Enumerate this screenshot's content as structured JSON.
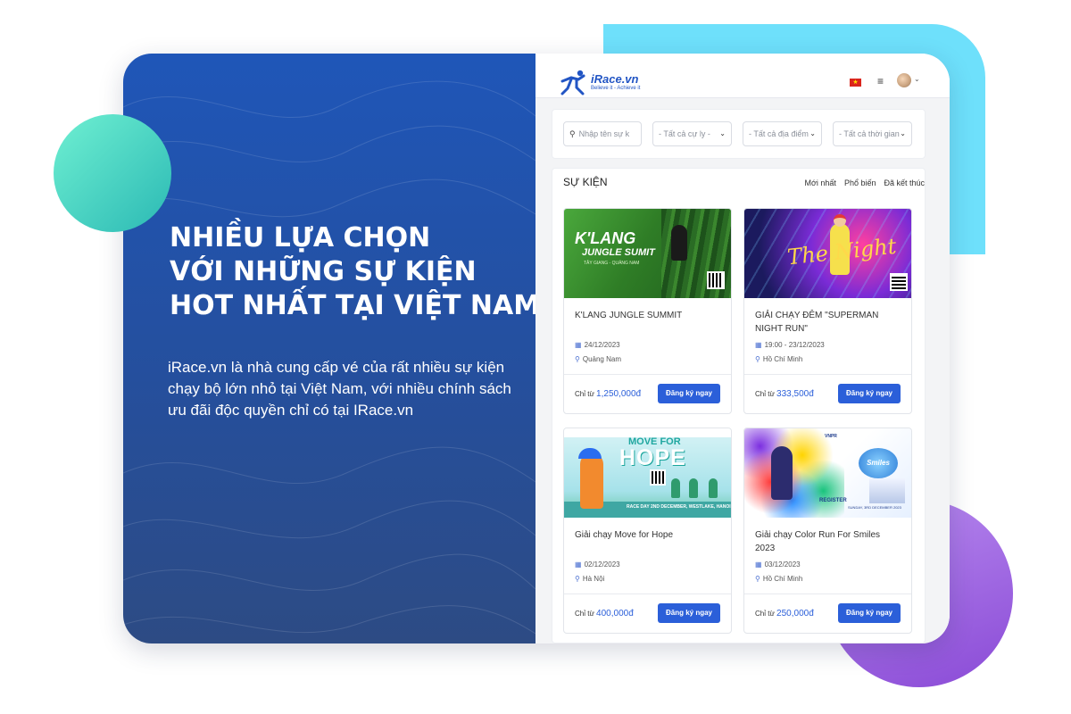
{
  "hero": {
    "headline_lines": [
      "NHIỀU LỰA CHỌN",
      "VỚI NHỮNG SỰ KIỆN",
      "HOT NHẤT TẠI VIỆT NAM"
    ],
    "description": "iRace.vn là nhà cung cấp vé của rất nhiều sự kiện chạy bộ lớn nhỏ tại Việt Nam, với nhiều chính sách ưu đãi độc quyền chỉ có tại IRace.vn"
  },
  "app": {
    "logo_title": "iRace.vn",
    "logo_tagline": "Believe it - Achieve it",
    "menu_icon": "hamburger-menu-icon",
    "flag": "vietnam-flag-icon"
  },
  "filters": {
    "search_placeholder": "Nhập tên sự k",
    "distance": "- Tất cả cự ly -",
    "location": "- Tất cả địa điểm",
    "time": "- Tất cả thời gian"
  },
  "events_section": {
    "title": "SỰ KIỆN",
    "tabs": [
      "Mới nhất",
      "Phổ biến",
      "Đã kết thúc"
    ],
    "price_prefix": "Chỉ từ",
    "register_label": "Đăng ký ngay",
    "items": [
      {
        "name": "K'LANG JUNGLE SUMMIT",
        "date": "24/12/2023",
        "location": "Quảng Nam",
        "price": "1,250,000đ",
        "banner_text": [
          "K'LANG",
          "JUNGLE SUMIT",
          "TÂY GIANG - QUẢNG NAM"
        ]
      },
      {
        "name": "GIẢI CHẠY ĐÊM \"SUPERMAN NIGHT RUN\"",
        "date": "19:00 - 23/12/2023",
        "location": "Hồ Chí Minh",
        "price": "333,500đ",
        "banner_text": [
          "The Night"
        ]
      },
      {
        "name": "Giải chạy Move for Hope",
        "date": "02/12/2023",
        "location": "Hà Nội",
        "price": "400,000đ",
        "banner_text": [
          "MOVE FOR",
          "HOPE",
          "RACE DAY 2ND DECEMBER, WESTLAKE, HANOI"
        ]
      },
      {
        "name": "Giải chạy Color Run For Smiles 2023",
        "date": "03/12/2023",
        "location": "Hồ Chí Minh",
        "price": "250,000đ",
        "banner_text": [
          "VNPR",
          "Smiles",
          "REGISTER",
          "SUNDAY, 3RD DECEMBER 2023"
        ]
      }
    ]
  },
  "colors": {
    "primary": "#2b5fd9",
    "hero_blue": "#1f56b8",
    "accent_cyan": "#6ee0fb",
    "accent_teal": "#2bb9b4",
    "accent_purple": "#8a4ad6"
  }
}
